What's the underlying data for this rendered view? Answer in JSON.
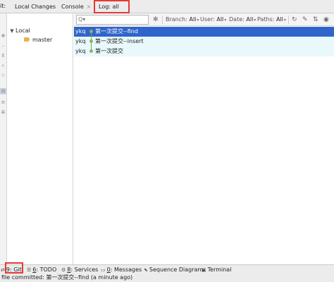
{
  "tool_window": {
    "prefix": "it:",
    "tabs": [
      {
        "label": "Local Changes",
        "closable": false,
        "active": false
      },
      {
        "label": "Console",
        "closable": true,
        "close_glyph": "×",
        "active": false
      },
      {
        "label": "Log: all",
        "closable": false,
        "active": true
      }
    ]
  },
  "left_strip": {
    "icons": [
      "move-icon",
      "delete-icon",
      "expand-icon",
      "search-icon",
      "star-icon",
      "preview-icon",
      "layout-icon",
      "details-icon"
    ]
  },
  "branch_tree": {
    "root": {
      "label": "Local",
      "expanded": true,
      "arrow": "▼"
    },
    "branches": [
      {
        "label": "master",
        "icon": "branch-tag-icon"
      }
    ]
  },
  "log_toolbar": {
    "search": {
      "value": "",
      "icon": "magnifier-icon",
      "icon_glyph": "Q▾"
    },
    "settings_icon": "✻",
    "filters": [
      {
        "label": "Branch:",
        "value": "All"
      },
      {
        "label": "User:",
        "value": "All"
      },
      {
        "label": "Date:",
        "value": "All"
      },
      {
        "label": "Paths:",
        "value": "All"
      }
    ],
    "dropdown_glyph": "▾",
    "right_icons": [
      {
        "name": "refresh-icon",
        "glyph": "↻"
      },
      {
        "name": "cherry-pick-icon",
        "glyph": "✎"
      },
      {
        "name": "intellisort-icon",
        "glyph": "⇅"
      },
      {
        "name": "view-options-icon",
        "glyph": "◉"
      }
    ]
  },
  "commits": [
    {
      "author": "ykq",
      "message": "第一次提交--find",
      "selected": true
    },
    {
      "author": "ykq",
      "message": "第一次提交--insert",
      "selected": false
    },
    {
      "author": "ykq",
      "message": "第一次提交",
      "selected": false
    }
  ],
  "bottom_tabs": [
    {
      "mnemonic": "9",
      "label": ": Git",
      "icon": "git-icon",
      "glyph": "⇄",
      "active": true
    },
    {
      "mnemonic": "6",
      "label": ": TODO",
      "icon": "todo-icon",
      "glyph": "☰",
      "active": false
    },
    {
      "mnemonic": "8",
      "label": ": Services",
      "icon": "services-icon",
      "glyph": "⚙",
      "active": false
    },
    {
      "mnemonic": "0",
      "label": ": Messages",
      "icon": "messages-icon",
      "glyph": "▭",
      "active": false
    },
    {
      "mnemonic": "",
      "label": "Sequence Diagram",
      "icon": "sequence-diagram-icon",
      "glyph": "⬉",
      "active": false
    },
    {
      "mnemonic": "",
      "label": "Terminal",
      "icon": "terminal-icon",
      "glyph": "▣",
      "active": false
    }
  ],
  "status_bar": {
    "text": "file committed: 第一次提交--find (a minute ago)"
  },
  "accent": {
    "selection": "#2f65ca",
    "highlight_box": "#e53935",
    "graph": "#8bb463"
  }
}
